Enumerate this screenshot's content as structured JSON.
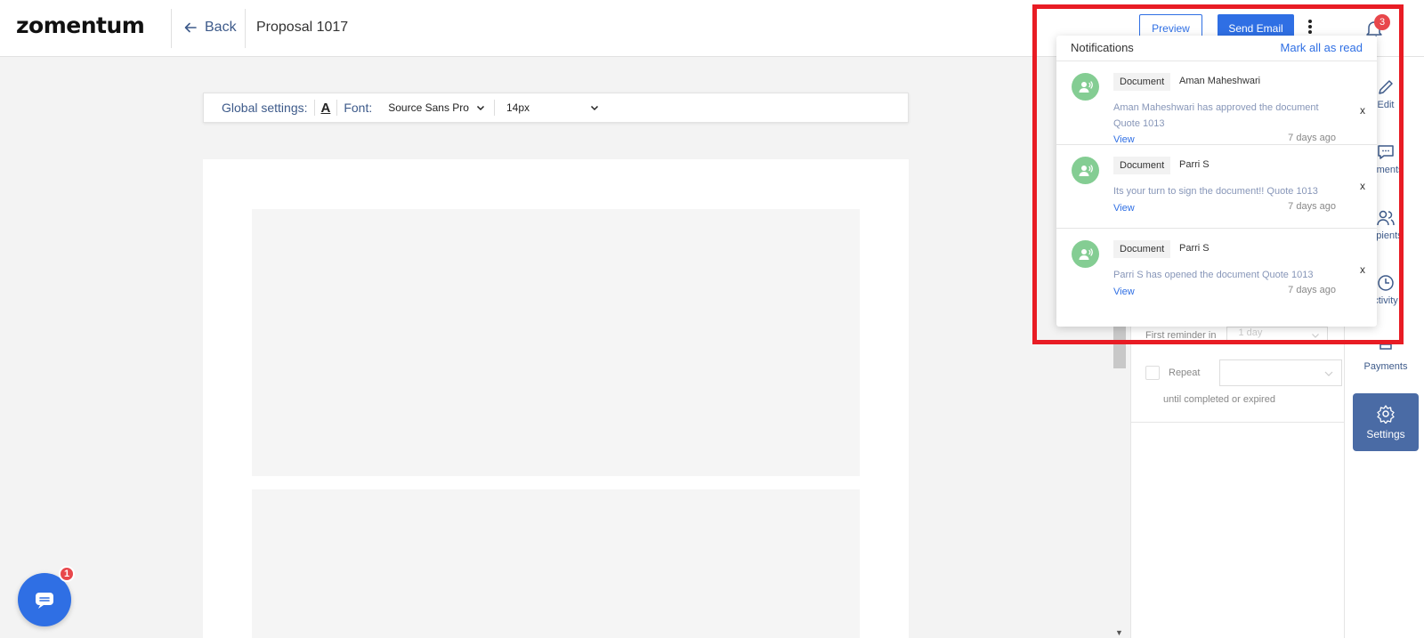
{
  "header": {
    "logo": "zomentum",
    "back_label": "Back",
    "doc_title": "Proposal 1017",
    "preview_label": "Preview",
    "send_email_label": "Send Email",
    "notification_count": "3"
  },
  "global_settings": {
    "label": "Global settings:",
    "font_color_glyph": "A",
    "font_label": "Font:",
    "font_value": "Source Sans Pro",
    "size_value": "14px"
  },
  "settings_panel": {
    "first_reminder_label": "First reminder in",
    "first_reminder_value": "1 day",
    "repeat_label": "Repeat",
    "until_label": "until completed or expired"
  },
  "rail": {
    "edit": "Edit",
    "comments": "mments",
    "recipients": "cipients",
    "activity": "ctivity",
    "payments": "Payments",
    "settings": "Settings"
  },
  "notifications": {
    "title": "Notifications",
    "mark_all": "Mark all as read",
    "items": [
      {
        "type": "Document",
        "sender": "Aman Maheshwari",
        "message": "Aman Maheshwari has approved the document Quote 1013",
        "view": "View",
        "time": "7 days ago",
        "close": "x"
      },
      {
        "type": "Document",
        "sender": "Parri S",
        "message": "Its your turn to sign the document!! Quote 1013",
        "view": "View",
        "time": "7 days ago",
        "close": "x"
      },
      {
        "type": "Document",
        "sender": "Parri S",
        "message": "Parri S has opened the document Quote 1013",
        "view": "View",
        "time": "7 days ago",
        "close": "x"
      }
    ]
  },
  "chat": {
    "badge": "1"
  },
  "colors": {
    "accent": "#2f6fe4",
    "nav_text": "#3d5a8a",
    "avatar": "#84cd93",
    "badge": "#e8474b",
    "highlight": "#e81c24",
    "settings_active": "#4a6ba5"
  }
}
